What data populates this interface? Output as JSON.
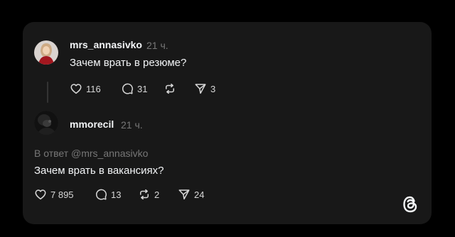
{
  "post1": {
    "username": "mrs_annasivko",
    "time": "21 ч.",
    "text": "Зачем врать в резюме?",
    "likes": "116",
    "comments": "31",
    "reposts": "",
    "shares": "3"
  },
  "post2": {
    "username": "mmorecil",
    "time": "21 ч.",
    "reply_to": "В ответ @mrs_annasivko",
    "text": "Зачем врать в вакансиях?",
    "likes": "7 895",
    "comments": "13",
    "reposts": "2",
    "shares": "24"
  },
  "icons": {
    "like": "heart-icon",
    "comment": "comment-bubble-icon",
    "repost": "repost-icon",
    "share": "send-icon",
    "brand": "threads-logo-icon"
  },
  "colors": {
    "background": "#000000",
    "card": "#181818",
    "text": "#f3f5f7",
    "muted": "#777777"
  }
}
